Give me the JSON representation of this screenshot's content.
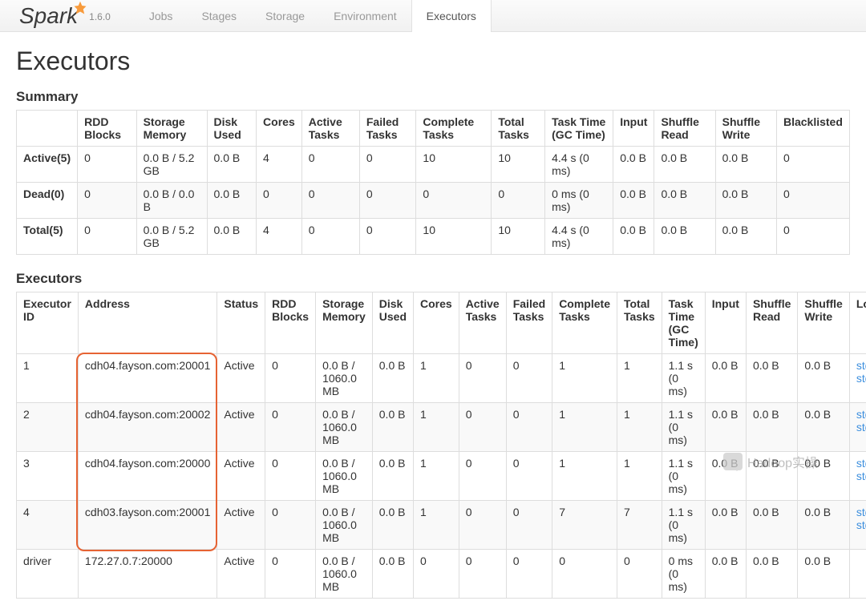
{
  "logo_text": "Spark",
  "logo_version": "1.6.0",
  "nav": {
    "items": [
      "Jobs",
      "Stages",
      "Storage",
      "Environment",
      "Executors"
    ],
    "active_index": 4
  },
  "page_heading": "Executors",
  "summary": {
    "heading": "Summary",
    "columns": [
      "",
      "RDD Blocks",
      "Storage Memory",
      "Disk Used",
      "Cores",
      "Active Tasks",
      "Failed Tasks",
      "Complete Tasks",
      "Total Tasks",
      "Task Time (GC Time)",
      "Input",
      "Shuffle Read",
      "Shuffle Write",
      "Blacklisted"
    ],
    "rows": [
      {
        "label": "Active(5)",
        "rdd_blocks": "0",
        "storage_memory": "0.0 B / 5.2 GB",
        "disk_used": "0.0 B",
        "cores": "4",
        "active_tasks": "0",
        "failed_tasks": "0",
        "complete_tasks": "10",
        "total_tasks": "10",
        "task_time": "4.4 s (0 ms)",
        "input": "0.0 B",
        "shuffle_read": "0.0 B",
        "shuffle_write": "0.0 B",
        "blacklisted": "0"
      },
      {
        "label": "Dead(0)",
        "rdd_blocks": "0",
        "storage_memory": "0.0 B / 0.0 B",
        "disk_used": "0.0 B",
        "cores": "0",
        "active_tasks": "0",
        "failed_tasks": "0",
        "complete_tasks": "0",
        "total_tasks": "0",
        "task_time": "0 ms (0 ms)",
        "input": "0.0 B",
        "shuffle_read": "0.0 B",
        "shuffle_write": "0.0 B",
        "blacklisted": "0"
      },
      {
        "label": "Total(5)",
        "rdd_blocks": "0",
        "storage_memory": "0.0 B / 5.2 GB",
        "disk_used": "0.0 B",
        "cores": "4",
        "active_tasks": "0",
        "failed_tasks": "0",
        "complete_tasks": "10",
        "total_tasks": "10",
        "task_time": "4.4 s (0 ms)",
        "input": "0.0 B",
        "shuffle_read": "0.0 B",
        "shuffle_write": "0.0 B",
        "blacklisted": "0"
      }
    ]
  },
  "executors": {
    "heading": "Executors",
    "columns": [
      "Executor ID",
      "Address",
      "Status",
      "RDD Blocks",
      "Storage Memory",
      "Disk Used",
      "Cores",
      "Active Tasks",
      "Failed Tasks",
      "Complete Tasks",
      "Total Tasks",
      "Task Time (GC Time)",
      "Input",
      "Shuffle Read",
      "Shuffle Write",
      "Logs"
    ],
    "rows": [
      {
        "id": "1",
        "address": "cdh04.fayson.com:20001",
        "status": "Active",
        "rdd_blocks": "0",
        "storage_memory": "0.0 B / 1060.0 MB",
        "disk_used": "0.0 B",
        "cores": "1",
        "active_tasks": "0",
        "failed_tasks": "0",
        "complete_tasks": "1",
        "total_tasks": "1",
        "task_time": "1.1 s (0 ms)",
        "input": "0.0 B",
        "shuffle_read": "0.0 B",
        "shuffle_write": "0.0 B",
        "log_stdout": "stdout",
        "log_stderr": "stderr"
      },
      {
        "id": "2",
        "address": "cdh04.fayson.com:20002",
        "status": "Active",
        "rdd_blocks": "0",
        "storage_memory": "0.0 B / 1060.0 MB",
        "disk_used": "0.0 B",
        "cores": "1",
        "active_tasks": "0",
        "failed_tasks": "0",
        "complete_tasks": "1",
        "total_tasks": "1",
        "task_time": "1.1 s (0 ms)",
        "input": "0.0 B",
        "shuffle_read": "0.0 B",
        "shuffle_write": "0.0 B",
        "log_stdout": "stdout",
        "log_stderr": "stderr"
      },
      {
        "id": "3",
        "address": "cdh04.fayson.com:20000",
        "status": "Active",
        "rdd_blocks": "0",
        "storage_memory": "0.0 B / 1060.0 MB",
        "disk_used": "0.0 B",
        "cores": "1",
        "active_tasks": "0",
        "failed_tasks": "0",
        "complete_tasks": "1",
        "total_tasks": "1",
        "task_time": "1.1 s (0 ms)",
        "input": "0.0 B",
        "shuffle_read": "0.0 B",
        "shuffle_write": "0.0 B",
        "log_stdout": "stdout",
        "log_stderr": "stderr"
      },
      {
        "id": "4",
        "address": "cdh03.fayson.com:20001",
        "status": "Active",
        "rdd_blocks": "0",
        "storage_memory": "0.0 B / 1060.0 MB",
        "disk_used": "0.0 B",
        "cores": "1",
        "active_tasks": "0",
        "failed_tasks": "0",
        "complete_tasks": "7",
        "total_tasks": "7",
        "task_time": "1.1 s (0 ms)",
        "input": "0.0 B",
        "shuffle_read": "0.0 B",
        "shuffle_write": "0.0 B",
        "log_stdout": "stdout",
        "log_stderr": "stderr"
      },
      {
        "id": "driver",
        "address": "172.27.0.7:20000",
        "status": "Active",
        "rdd_blocks": "0",
        "storage_memory": "0.0 B / 1060.0 MB",
        "disk_used": "0.0 B",
        "cores": "0",
        "active_tasks": "0",
        "failed_tasks": "0",
        "complete_tasks": "0",
        "total_tasks": "0",
        "task_time": "0 ms (0 ms)",
        "input": "0.0 B",
        "shuffle_read": "0.0 B",
        "shuffle_write": "0.0 B",
        "log_stdout": "",
        "log_stderr": ""
      }
    ]
  },
  "watermark": "Hadoop实操"
}
